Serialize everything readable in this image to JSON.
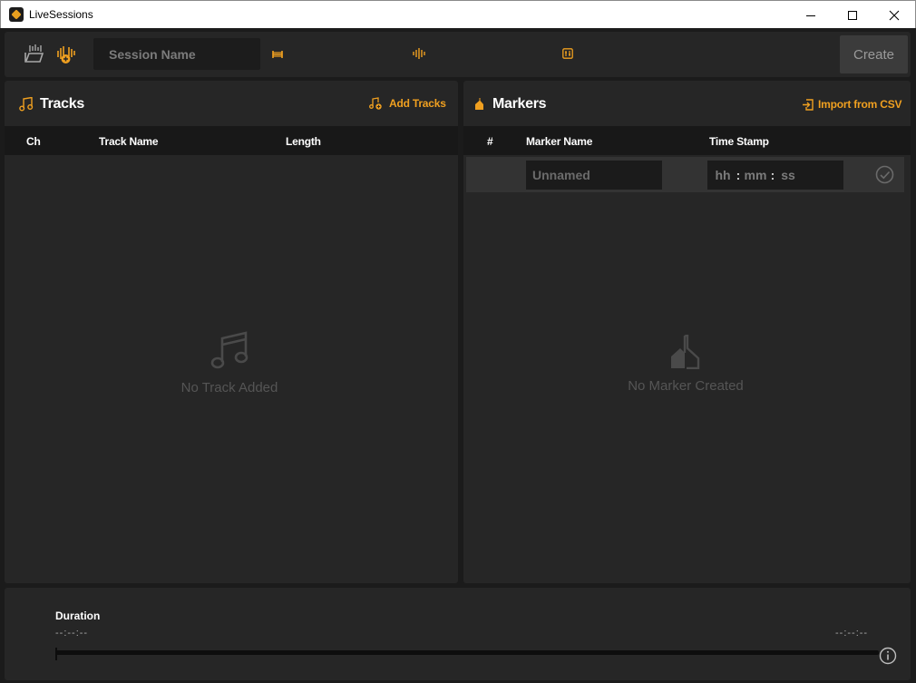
{
  "window": {
    "title": "LiveSessions"
  },
  "toolbar": {
    "session_placeholder": "Session Name",
    "create_label": "Create"
  },
  "tracks": {
    "title": "Tracks",
    "add_label": "Add Tracks",
    "columns": [
      "Ch",
      "Track Name",
      "Length"
    ],
    "empty_text": "No Track Added"
  },
  "markers": {
    "title": "Markers",
    "import_label": "Import from CSV",
    "columns": [
      "#",
      "Marker Name",
      "Time Stamp"
    ],
    "name_placeholder": "Unnamed",
    "time_placeholders": {
      "hh": "hh",
      "mm": "mm",
      "ss": "ss"
    },
    "time_separator": ":",
    "empty_text": "No Marker Created"
  },
  "duration": {
    "label": "Duration",
    "start": "--:--:--",
    "end": "--:--:--",
    "progress": 0
  },
  "colors": {
    "accent": "#f0a020",
    "panel": "#262626",
    "background": "#1b1b1b"
  }
}
